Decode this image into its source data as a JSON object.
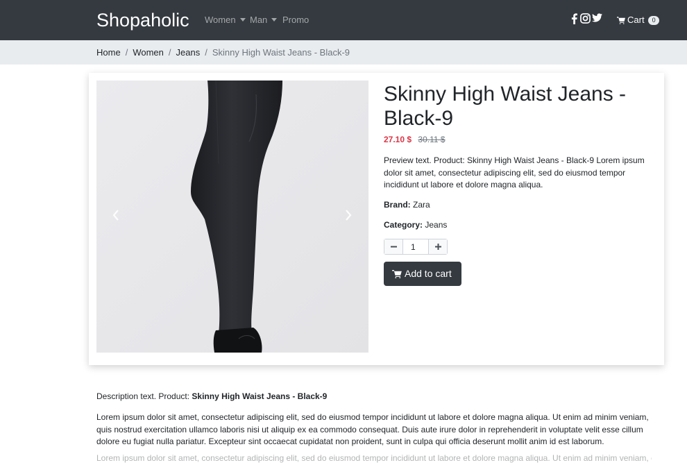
{
  "navbar": {
    "brand": "Shopaholic",
    "links": [
      {
        "label": "Women",
        "dropdown": true
      },
      {
        "label": "Man",
        "dropdown": true
      },
      {
        "label": "Promo",
        "dropdown": false
      }
    ],
    "social_icons": [
      "facebook-icon",
      "instagram-icon",
      "twitter-icon"
    ],
    "cart_label": "Cart",
    "cart_count": "0"
  },
  "breadcrumb": {
    "items": [
      "Home",
      "Women",
      "Jeans"
    ],
    "active": "Skinny High Waist Jeans - Black-9",
    "separator": "/"
  },
  "product": {
    "title": "Skinny High Waist Jeans - Black-9",
    "price": "27.10 $",
    "old_price": "30.11 $",
    "preview_text": "Preview text. Product: Skinny High Waist Jeans - Black-9 Lorem ipsum dolor sit amet, consectetur adipiscing elit, sed do eiusmod tempor incididunt ut labore et dolore magna aliqua.",
    "brand_label": "Brand:",
    "brand_value": "Zara",
    "category_label": "Category:",
    "category_value": "Jeans",
    "quantity": "1",
    "add_to_cart_label": "Add to cart",
    "image_icon": "product-photo-jeans"
  },
  "description": {
    "intro": "Description text. Product:",
    "intro_product": "Skinny High Waist Jeans - Black-9",
    "body": "Lorem ipsum dolor sit amet, consectetur adipiscing elit, sed do eiusmod tempor incididunt ut labore et dolore magna aliqua. Ut enim ad minim veniam, quis nostrud exercitation ullamco laboris nisi ut aliquip ex ea commodo consequat. Duis aute irure dolor in reprehenderit in voluptate velit esse cillum dolore eu fugiat nulla pariatur. Excepteur sint occaecat cupidatat non proident, sunt in culpa qui officia deserunt mollit anim id est laborum."
  },
  "colors": {
    "navbar_bg": "#343a40",
    "breadcrumb_bg": "#e9ecef",
    "price_red": "#dc3545",
    "button_dark": "#343a40"
  }
}
